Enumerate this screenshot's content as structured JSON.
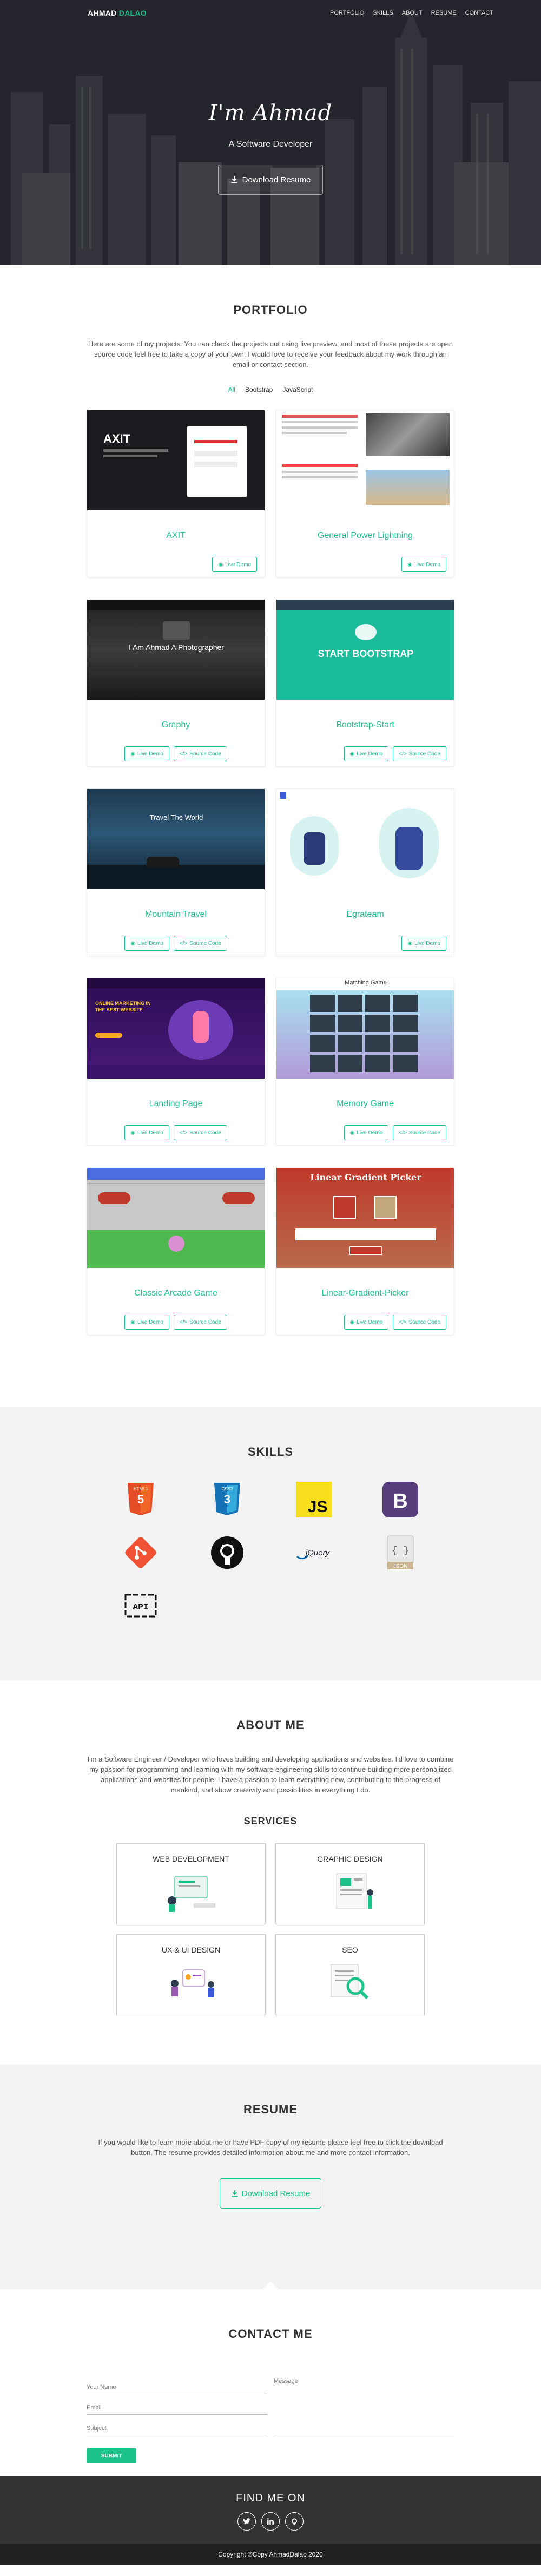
{
  "nav": {
    "brand_first": "AHMAD",
    "brand_last": " DALAO",
    "links": [
      "PORTFOLIO",
      "SKILLS",
      "ABOUT",
      "RESUME",
      "CONTACT"
    ]
  },
  "hero": {
    "title": "I'm Ahmad",
    "subtitle": "A Software Developer",
    "button": "Download Resume"
  },
  "portfolio": {
    "title": "PORTFOLIO",
    "intro": "Here are some of my projects. You can check the projects out using live preview, and most of these projects are open source code feel free to take a copy of your own, I would love to receive your feedback about my work through an email or contact section.",
    "filters": [
      "All",
      "Bootstrap",
      "JavaScript"
    ],
    "live_label": "Live Demo",
    "source_label": "Source Code",
    "projects": [
      {
        "name": "AXIT",
        "thumb_text": "AXIT",
        "has_source": false
      },
      {
        "name": "General Power Lightning",
        "thumb_text": "",
        "has_source": false
      },
      {
        "name": "Graphy",
        "thumb_text": "I Am Ahmad A Photographer",
        "has_source": true
      },
      {
        "name": "Bootstrap-Start",
        "thumb_text": "START BOOTSTRAP",
        "has_source": true
      },
      {
        "name": "Mountain Travel",
        "thumb_text": "Travel The World",
        "has_source": true
      },
      {
        "name": "Egrateam",
        "thumb_text": "",
        "has_source": false
      },
      {
        "name": "Landing Page",
        "thumb_text": "ONLINE MARKETING IN THE BEST WEBSITE",
        "has_source": true
      },
      {
        "name": "Memory Game",
        "thumb_text": "Matching Game",
        "has_source": true
      },
      {
        "name": "Classic Arcade Game",
        "thumb_text": "",
        "has_source": true
      },
      {
        "name": "Linear-Gradient-Picker",
        "thumb_text": "Linear Gradient Picker",
        "has_source": true
      }
    ]
  },
  "skills": {
    "title": "SKILLS",
    "items": [
      "HTML5",
      "CSS3",
      "JS",
      "Bootstrap",
      "Git",
      "GitHub",
      "jQuery",
      "JSON",
      "API"
    ]
  },
  "about": {
    "title": "ABOUT ME",
    "text": "I'm a Software Engineer / Developer who loves building and developing applications and websites. I'd love to combine my passion for programming and learning with my software engineering skills to continue building more personalized applications and websites for people. I have a passion to learn everything new, contributing to the progress of mankind, and show creativity and possibilities in everything I do.",
    "services_title": "SERVICES",
    "services": [
      "WEB DEVELOPMENT",
      "GRAPHIC DESIGN",
      "UX & UI DESIGN",
      "SEO"
    ]
  },
  "resume": {
    "title": "RESUME",
    "text": "If you would like to learn more about me or have PDF copy of my resume please feel free to click the download button. The resume provides detailed information about me and more contact information.",
    "button": "Download Resume"
  },
  "contact": {
    "title": "CONTACT ME",
    "name_placeholder": "Your Name",
    "email_placeholder": "Email",
    "subject_placeholder": "Subject",
    "message_placeholder": "Message",
    "submit": "SUBMIT"
  },
  "footer": {
    "title": "FIND ME ON",
    "socials": [
      "twitter-icon",
      "linkedin-icon",
      "github-icon"
    ],
    "copyright": "Copyright ©Copy AhmadDalao 2020"
  },
  "colors": {
    "accent": "#1ec28b",
    "dark": "#333333",
    "light_bg": "#f2f2f2"
  }
}
